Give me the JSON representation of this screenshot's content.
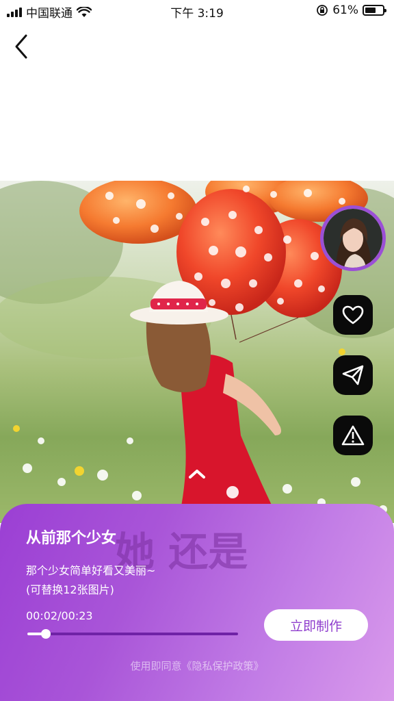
{
  "status_bar": {
    "carrier": "中国联通",
    "time": "下午 3:19",
    "battery_percent": "61%",
    "battery_level": 0.61,
    "icons": [
      "signal-icon",
      "wifi-icon",
      "rotation-lock-icon",
      "battery-icon"
    ]
  },
  "nav": {
    "back_icon": "chevron-left-icon"
  },
  "side_actions": {
    "icons": [
      "heart-icon",
      "send-icon",
      "warning-icon"
    ]
  },
  "template": {
    "title": "从前那个少女",
    "description_line1": "那个少女简单好看又美丽~",
    "description_line2": "(可替换12张图片)",
    "watermark_text": "她  还是",
    "playback_time": "00:02/00:23",
    "progress": 0.087,
    "make_button_label": "立即制作",
    "agreement_text": "使用即同意《隐私保护政策》"
  },
  "colors": {
    "accent": "#9b4fd6",
    "panel_start": "#9b3fd4",
    "panel_end": "#d99aeb",
    "button_text": "#8e3ccd"
  }
}
